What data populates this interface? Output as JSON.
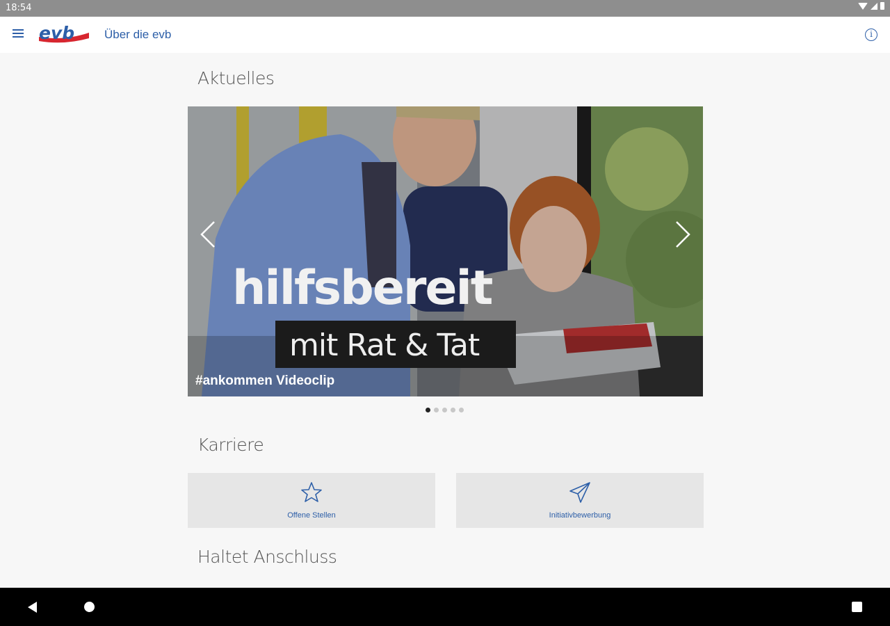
{
  "status_bar": {
    "time": "18:54"
  },
  "app_bar": {
    "logo_text": "evb",
    "title": "Über die evb",
    "info_glyph": "i"
  },
  "sections": {
    "news": "Aktuelles",
    "career": "Karriere",
    "stay_connected": "Haltet Anschluss"
  },
  "carousel": {
    "headline": "hilfsbereit",
    "subline": "mit Rat & Tat",
    "caption": "#ankommen Videoclip",
    "slide_count": 5,
    "active_slide": 1
  },
  "career_tiles": [
    {
      "label": "Offene Stellen",
      "icon": "star-icon"
    },
    {
      "label": "Initiativbewerbung",
      "icon": "paper-plane-icon"
    }
  ],
  "colors": {
    "brand_blue": "#2d5fa8",
    "brand_red": "#d7262f",
    "tile_background": "#e6e6e6",
    "page_background": "#f7f7f7"
  }
}
